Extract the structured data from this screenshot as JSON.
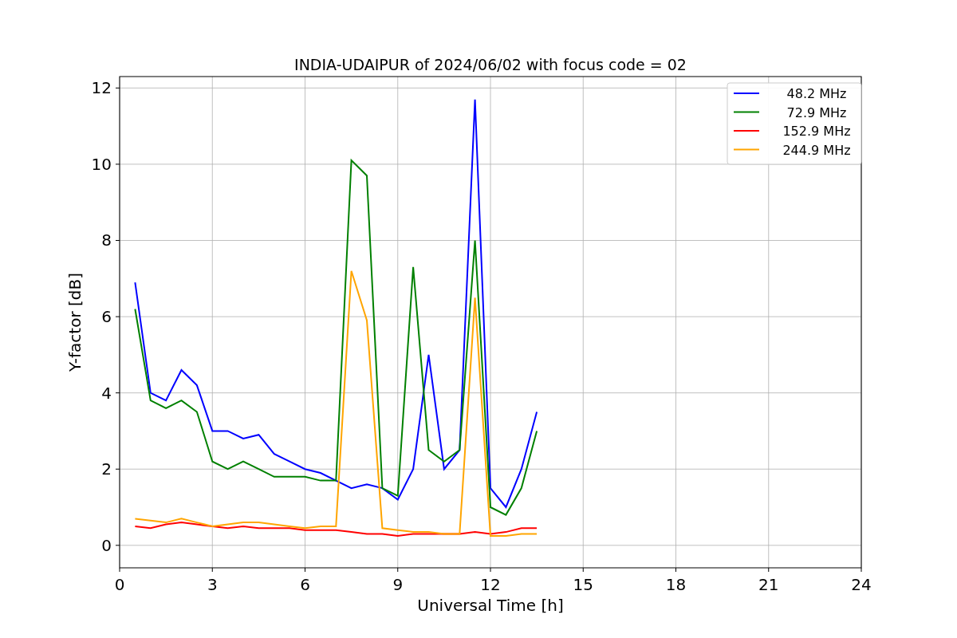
{
  "figure": {
    "chart_data": {
      "type": "line",
      "title": "INDIA-UDAIPUR of 2024/06/02 with focus code = 02",
      "xlabel": "Universal Time [h]",
      "ylabel": "Y-factor [dB]",
      "x": [
        0.5,
        1,
        1.5,
        2,
        2.5,
        3,
        3.5,
        4,
        4.5,
        5,
        5.5,
        6,
        6.5,
        7,
        7.5,
        8,
        8.5,
        9,
        9.5,
        10,
        10.5,
        11,
        11.5,
        12,
        12.5,
        13,
        13.5
      ],
      "series": [
        {
          "name": "48.2 MHz",
          "color": "#0000ff",
          "values": [
            6.9,
            4.0,
            3.8,
            4.6,
            4.2,
            3.0,
            3.0,
            2.8,
            2.9,
            2.4,
            2.2,
            2.0,
            1.9,
            1.7,
            1.5,
            1.6,
            1.5,
            1.2,
            2.0,
            5.0,
            2.0,
            2.5,
            11.7,
            1.5,
            1.0,
            2.0,
            3.5
          ]
        },
        {
          "name": "72.9 MHz",
          "color": "#008000",
          "values": [
            6.2,
            3.8,
            3.6,
            3.8,
            3.5,
            2.2,
            2.0,
            2.2,
            2.0,
            1.8,
            1.8,
            1.8,
            1.7,
            1.7,
            10.1,
            9.7,
            1.5,
            1.3,
            7.3,
            2.5,
            2.2,
            2.5,
            8.0,
            1.0,
            0.8,
            1.5,
            3.0
          ]
        },
        {
          "name": "152.9 MHz",
          "color": "#ff0000",
          "values": [
            0.5,
            0.45,
            0.55,
            0.6,
            0.55,
            0.5,
            0.45,
            0.5,
            0.45,
            0.45,
            0.45,
            0.4,
            0.4,
            0.4,
            0.35,
            0.3,
            0.3,
            0.25,
            0.3,
            0.3,
            0.3,
            0.3,
            0.35,
            0.3,
            0.35,
            0.45,
            0.45
          ]
        },
        {
          "name": "244.9 MHz",
          "color": "#ffa500",
          "values": [
            0.7,
            0.65,
            0.6,
            0.7,
            0.6,
            0.5,
            0.55,
            0.6,
            0.6,
            0.55,
            0.5,
            0.45,
            0.5,
            0.5,
            7.2,
            5.9,
            0.45,
            0.4,
            0.35,
            0.35,
            0.3,
            0.3,
            6.5,
            0.25,
            0.25,
            0.3,
            0.3
          ]
        }
      ],
      "xlim": [
        0,
        24
      ],
      "ylim": [
        -0.59,
        12.3
      ],
      "xticks": [
        0,
        3,
        6,
        9,
        12,
        15,
        18,
        21,
        24
      ],
      "yticks": [
        0,
        2,
        4,
        6,
        8,
        10,
        12
      ],
      "grid": true,
      "legend": true
    }
  }
}
